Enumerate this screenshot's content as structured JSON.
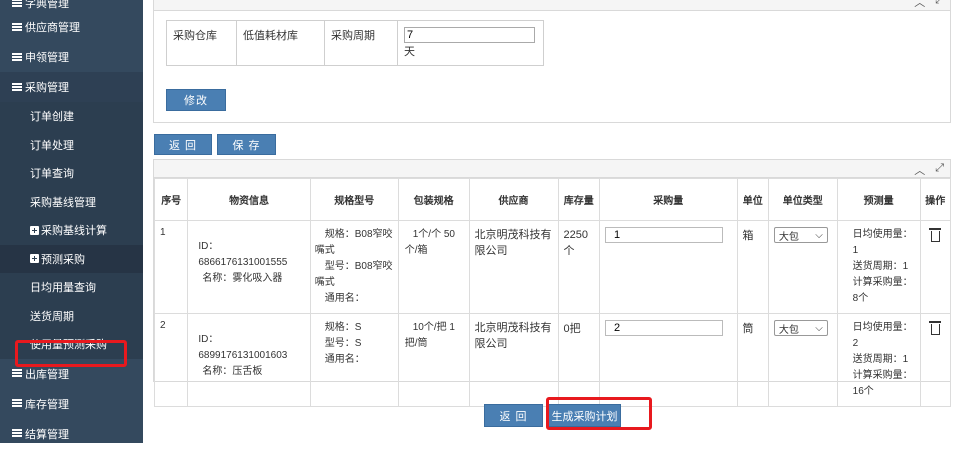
{
  "sidebar": {
    "top_partial": "字典管理",
    "groups_before": [
      "供应商管理",
      "申领管理"
    ],
    "active_group": "采购管理",
    "sub_items": [
      {
        "label": "订单创建",
        "plus": false
      },
      {
        "label": "订单处理",
        "plus": false
      },
      {
        "label": "订单查询",
        "plus": false
      },
      {
        "label": "采购基线管理",
        "plus": false
      },
      {
        "label": "采购基线计算",
        "plus": true
      },
      {
        "label": "预测采购",
        "plus": true
      },
      {
        "label": "日均用量查询",
        "plus": false
      },
      {
        "label": "送货周期",
        "plus": false
      },
      {
        "label": "使用量预测采购",
        "plus": false
      }
    ],
    "groups_after": [
      "出库管理",
      "库存管理",
      "结算管理"
    ]
  },
  "form": {
    "warehouse_label": "采购仓库",
    "warehouse_value": "低值耗材库",
    "period_label": "采购周期",
    "period_value": "7",
    "period_unit": "天",
    "edit_label": "修改"
  },
  "toolbar": {
    "back_label": "返 回",
    "save_label": "保 存"
  },
  "table": {
    "headers": [
      "序号",
      "物资信息",
      "规格型号",
      "包装规格",
      "供应商",
      "库存量",
      "采购量",
      "单位",
      "单位类型",
      "预测量",
      "操作"
    ],
    "rows": [
      {
        "index": "1",
        "material_id": "ID：6866176131001555",
        "material_name": "名称：雾化吸入器",
        "spec_line1": "规格：B08窄咬",
        "spec_line2": "嘴式",
        "model_line1": "型号：B08窄咬",
        "model_line2": "嘴式",
        "generic": "通用名：",
        "package_line1": "1个/个 50",
        "package_line2": "个/箱",
        "supplier": "北京明茂科技有限公司",
        "stock": "2250个",
        "purchase_qty": "1",
        "unit": "箱",
        "unit_type": "大包",
        "forecast_daily": "日均使用量：1",
        "forecast_cycle": "送货周期：1",
        "forecast_calc": "计算采购量：8个"
      },
      {
        "index": "2",
        "material_id": "ID：6899176131001603",
        "material_name": "名称：压舌板",
        "spec_line1": "规格：S",
        "model_line1": "型号：S",
        "generic": "通用名：",
        "package_line1": "10个/把 1",
        "package_line2": "把/筒",
        "supplier": "北京明茂科技有限公司",
        "stock": "0把",
        "purchase_qty": "2",
        "unit": "筒",
        "unit_type": "大包",
        "forecast_daily": "日均使用量：2",
        "forecast_cycle": "送货周期：1",
        "forecast_calc": "计算采购量：16个"
      }
    ]
  },
  "bottom": {
    "back_label": "返 回",
    "generate_label": "生成采购计划"
  },
  "colors": {
    "sidebar_bg": "#34495e",
    "button_blue": "#4a7fb3",
    "highlight_red": "#e8191e"
  }
}
